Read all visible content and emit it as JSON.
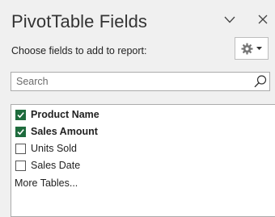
{
  "pane": {
    "title": "PivotTable Fields",
    "subtitle": "Choose fields to add to report:"
  },
  "search": {
    "placeholder": "Search",
    "value": ""
  },
  "fields": [
    {
      "label": "Product Name",
      "checked": true
    },
    {
      "label": "Sales Amount",
      "checked": true
    },
    {
      "label": "Units Sold",
      "checked": false
    },
    {
      "label": "Sales Date",
      "checked": false
    }
  ],
  "more_tables_label": "More Tables...",
  "icons": {
    "pane_options": "chevron-down-icon",
    "close": "close-icon",
    "settings": "gear-icon",
    "settings_dropdown": "caret-down-icon",
    "search": "search-icon",
    "checkmark": "checkmark-icon"
  },
  "colors": {
    "checkbox_checked": "#1e6b3d",
    "pane_background": "#f0f0f0"
  }
}
